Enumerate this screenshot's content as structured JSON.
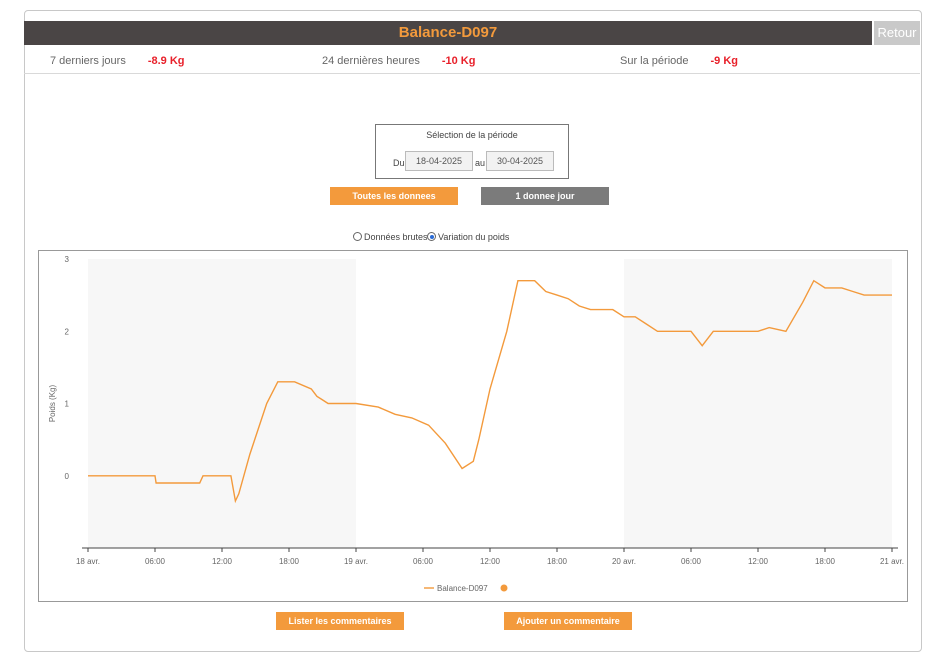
{
  "header": {
    "title": "Balance-D097",
    "back_label": "Retour"
  },
  "stats": [
    {
      "label": "7 derniers jours",
      "value": "-8.9 Kg"
    },
    {
      "label": "24 dernières heures",
      "value": "-10 Kg"
    },
    {
      "label": "Sur la période",
      "value": "-9 Kg"
    }
  ],
  "period": {
    "title": "Sélection de la période",
    "from_label": "Du",
    "to_label": "au",
    "from_value": "18-04-2025",
    "to_value": "30-04-2025"
  },
  "buttons": {
    "all_data": "Toutes les donnees",
    "one_per_day": "1 donnee jour",
    "list_comments": "Lister les commentaires",
    "add_comment": "Ajouter un commentaire"
  },
  "options": {
    "raw": "Données brutes",
    "variation": "Variation du poids",
    "selected": "variation"
  },
  "colors": {
    "series": "#f39a3c",
    "accent_red": "#e8202a",
    "header_bg": "#4a4545"
  },
  "chart_data": {
    "type": "line",
    "ylabel": "Poids (Kg)",
    "ylim": [
      -1,
      3
    ],
    "y_ticks": [
      0,
      1,
      2,
      3
    ],
    "x_tick_labels": [
      "18 avr.",
      "06:00",
      "12:00",
      "18:00",
      "19 avr.",
      "06:00",
      "12:00",
      "18:00",
      "20 avr.",
      "06:00",
      "12:00",
      "18:00",
      "21 avr."
    ],
    "x_unit": "hours since 18 avr. 00:00",
    "x_range": [
      0,
      72
    ],
    "legend": "bottom-center",
    "series": [
      {
        "name": "Balance-D097",
        "x": [
          0,
          6,
          6.1,
          10,
          10.3,
          12.8,
          13.2,
          13.5,
          14.5,
          16,
          17,
          17.5,
          18.5,
          20,
          20.5,
          21,
          21.5,
          22,
          23,
          24,
          26,
          27.5,
          29,
          30.5,
          32,
          33.5,
          34.5,
          35,
          36,
          37.5,
          38.5,
          40,
          41,
          42,
          43,
          44,
          45,
          47,
          48,
          49,
          50,
          51,
          52,
          54,
          55,
          56,
          57,
          59,
          60,
          61,
          62.5,
          64,
          65,
          66,
          67.5,
          68.5,
          69.5,
          70,
          71,
          72
        ],
        "y": [
          0,
          0,
          -0.1,
          -0.1,
          0,
          0,
          -0.35,
          -0.25,
          0.3,
          1.0,
          1.3,
          1.3,
          1.3,
          1.2,
          1.1,
          1.05,
          1.0,
          1.0,
          1.0,
          1.0,
          0.95,
          0.85,
          0.8,
          0.7,
          0.45,
          0.1,
          0.2,
          0.5,
          1.2,
          2.0,
          2.7,
          2.7,
          2.55,
          2.5,
          2.45,
          2.35,
          2.3,
          2.3,
          2.2,
          2.2,
          2.1,
          2.0,
          2.0,
          2.0,
          1.8,
          2.0,
          2.0,
          2.0,
          2.0,
          2.05,
          2.0,
          2.4,
          2.7,
          2.6,
          2.6,
          2.55,
          2.5,
          2.5,
          2.5,
          2.5
        ]
      }
    ]
  }
}
